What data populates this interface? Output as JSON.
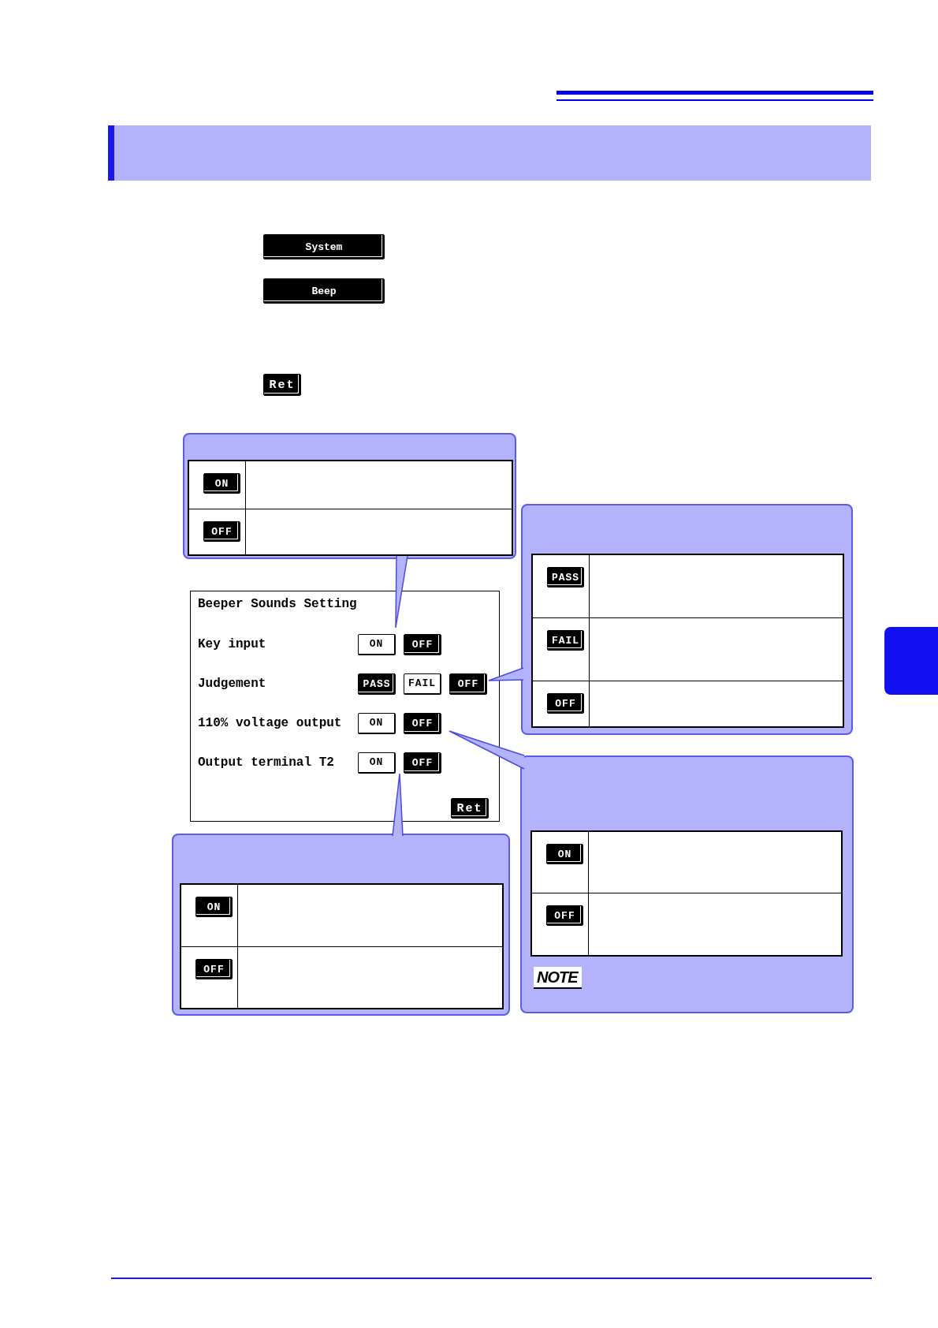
{
  "steps": [
    {
      "kind": "wide",
      "label": "System"
    },
    {
      "kind": "wide",
      "label": "Beep"
    },
    {
      "kind": "compact",
      "label": "Ret"
    }
  ],
  "callouts": [
    {
      "keys": [
        "ON",
        "OFF"
      ]
    },
    {
      "keys": [
        "PASS",
        "FAIL",
        "OFF"
      ]
    },
    {
      "keys": [
        "ON",
        "OFF"
      ],
      "note_mark": "NOTE"
    },
    {
      "keys": [
        "ON",
        "OFF"
      ]
    }
  ],
  "screen": {
    "title": "Beeper Sounds Setting",
    "rows": [
      {
        "label": "Key input",
        "options": [
          {
            "label": "ON",
            "selected": false
          },
          {
            "label": "OFF",
            "selected": true
          }
        ]
      },
      {
        "label": "Judgement",
        "options": [
          {
            "label": "PASS",
            "selected": true
          },
          {
            "label": "FAIL",
            "selected": false
          },
          {
            "label": "OFF",
            "selected": true
          }
        ]
      },
      {
        "label": "110% voltage output",
        "options": [
          {
            "label": "ON",
            "selected": false
          },
          {
            "label": "OFF",
            "selected": true
          }
        ]
      },
      {
        "label": "Output terminal T2",
        "options": [
          {
            "label": "ON",
            "selected": false
          },
          {
            "label": "OFF",
            "selected": true
          }
        ]
      }
    ],
    "return_button": "Ret"
  }
}
